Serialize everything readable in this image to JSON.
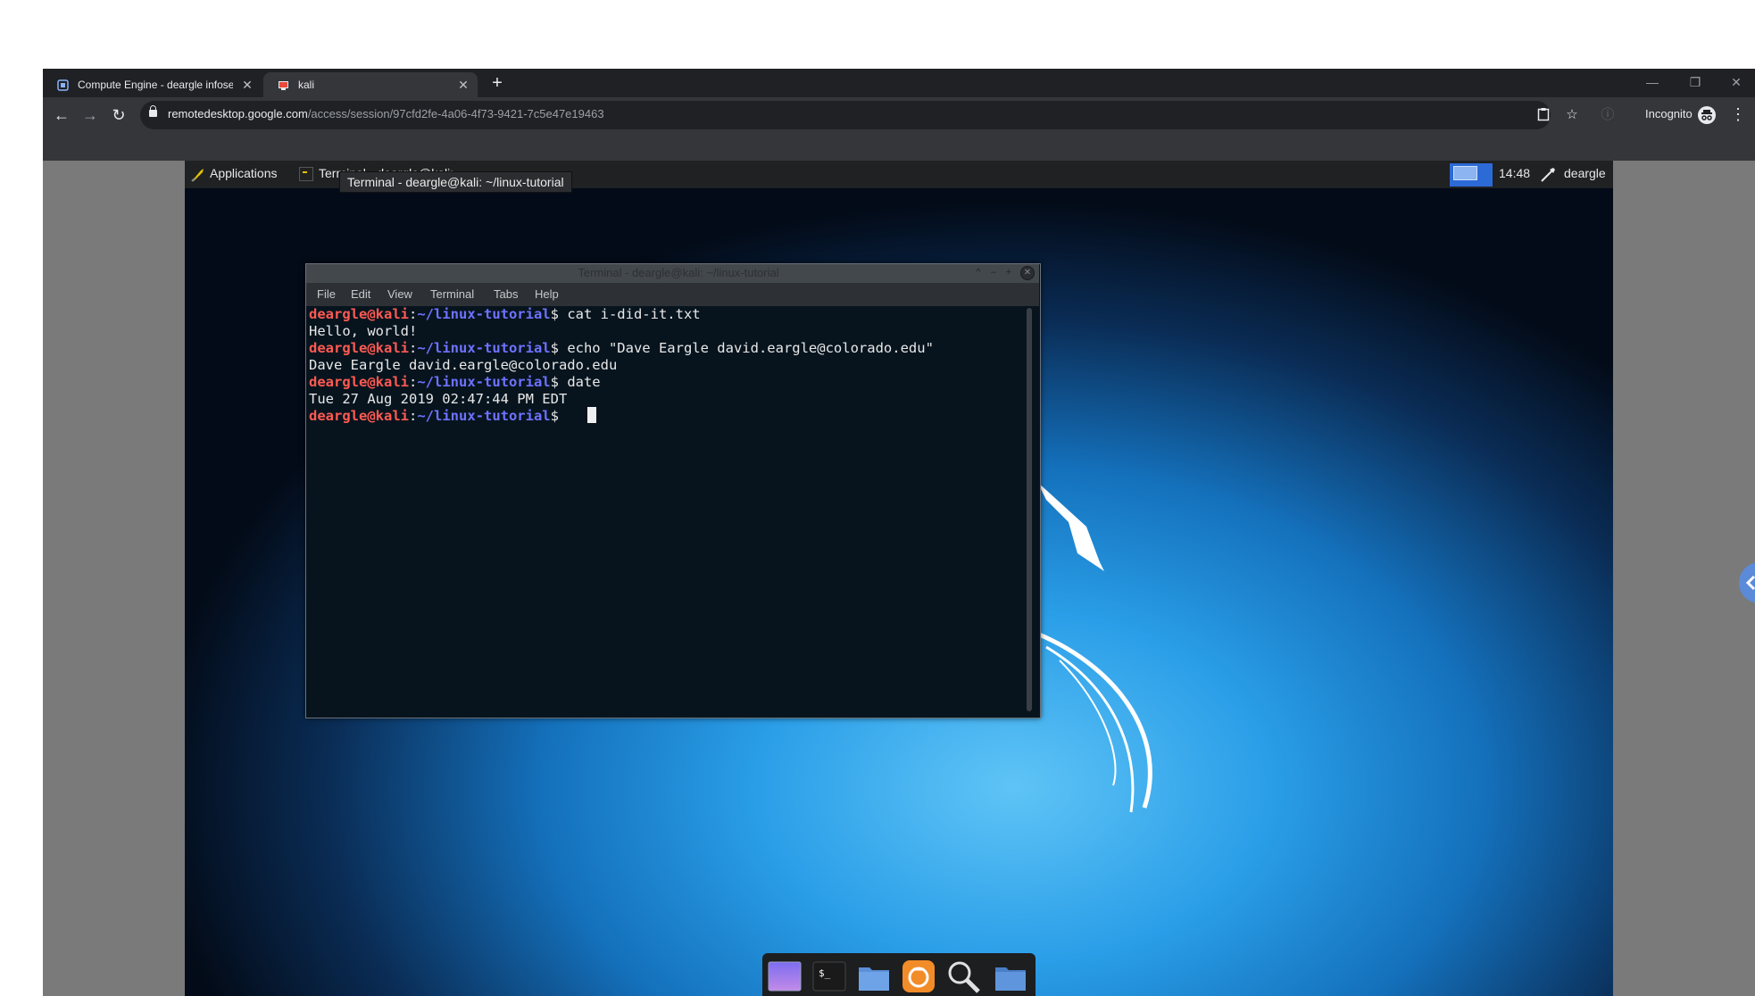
{
  "browser": {
    "tabs": [
      {
        "label": "Compute Engine - deargle infosec",
        "active": false
      },
      {
        "label": "kali",
        "active": true
      }
    ],
    "url": {
      "host": "remotedesktop.google.com",
      "path": "/access/session/97cfd2fe-4a06-4f73-9421-7c5e47e19463"
    },
    "incognito_label": "Incognito",
    "icons": {
      "back": "arrow-left-icon",
      "forward": "arrow-right-icon",
      "reload": "reload-icon",
      "lock": "lock-icon",
      "clipboard": "clipboard-icon",
      "star": "star-icon",
      "info": "info-icon",
      "menu": "three-dots-icon"
    }
  },
  "kali": {
    "panel": {
      "applications_label": "Applications",
      "task_label": "Terminal - deargle@kali: ~/linux-tutorial",
      "tooltip": "Terminal - deargle@kali: ~/linux-tutorial",
      "clock": "14:48",
      "user": "deargle"
    },
    "terminal": {
      "title": "Terminal - deargle@kali: ~/linux-tutorial",
      "menu": [
        "File",
        "Edit",
        "View",
        "Terminal",
        "Tabs",
        "Help"
      ],
      "prompt_user": "deargle@kali",
      "prompt_path": "~/linux-tutorial",
      "lines": [
        {
          "type": "cmd",
          "command": "cat i-did-it.txt"
        },
        {
          "type": "out",
          "text": "Hello, world!"
        },
        {
          "type": "cmd",
          "command": "echo \"Dave Eargle david.eargle@colorado.edu\""
        },
        {
          "type": "out",
          "text": "Dave Eargle david.eargle@colorado.edu"
        },
        {
          "type": "cmd",
          "command": "date"
        },
        {
          "type": "out",
          "text": "Tue 27 Aug 2019 02:47:44 PM EDT"
        },
        {
          "type": "cmd",
          "command": ""
        }
      ]
    },
    "dock": [
      "workspace-icon",
      "terminal-icon",
      "folder-icon",
      "firefox-icon",
      "search-icon",
      "home-folder-icon"
    ]
  },
  "colors": {
    "chrome_bg": "#202124",
    "toolbar_bg": "#35363a",
    "prompt_user": "#ff5a52",
    "prompt_path": "#6e72ff",
    "workspace_active": "#2c6ad6"
  }
}
